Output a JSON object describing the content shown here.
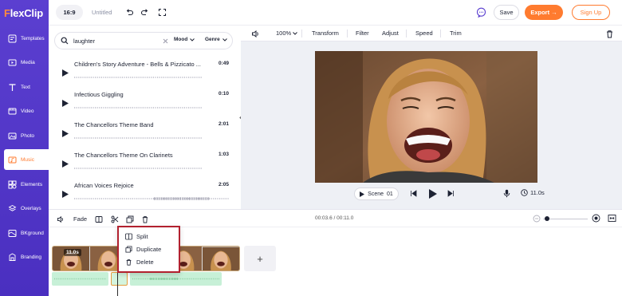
{
  "brand": {
    "logo_a": "F",
    "logo_b": "lexClip",
    "accent": "#ff7a2e",
    "sidebar_color": "#5233c8"
  },
  "sidebar": {
    "items": [
      {
        "label": "Templates",
        "icon": "templates-icon"
      },
      {
        "label": "Media",
        "icon": "media-icon"
      },
      {
        "label": "Text",
        "icon": "text-icon"
      },
      {
        "label": "Video",
        "icon": "video-icon"
      },
      {
        "label": "Photo",
        "icon": "photo-icon"
      },
      {
        "label": "Music",
        "icon": "music-icon",
        "active": true
      },
      {
        "label": "Elements",
        "icon": "elements-icon"
      },
      {
        "label": "Overlays",
        "icon": "overlays-icon"
      },
      {
        "label": "BKground",
        "icon": "background-icon"
      },
      {
        "label": "Branding",
        "icon": "branding-icon"
      }
    ]
  },
  "topbar": {
    "ratio": "16:9",
    "title": "Untitled",
    "save": "Save",
    "export": "Export →",
    "signup": "Sign Up"
  },
  "music": {
    "search_value": "laughter",
    "mood": "Mood",
    "genre": "Genre",
    "tracks": [
      {
        "name": "Children's Story Adventure - Bells & Pizzicato ...",
        "duration": "0:49"
      },
      {
        "name": "Infectious Giggling",
        "duration": "0:10"
      },
      {
        "name": "The Chancellors Theme Band",
        "duration": "2:01"
      },
      {
        "name": "The Chancellors Theme On Clarinets",
        "duration": "1:03"
      },
      {
        "name": "African Voices Rejoice",
        "duration": "2:05"
      }
    ]
  },
  "preview_toolbar": {
    "zoom": "100%",
    "transform": "Transform",
    "filter": "Filter",
    "adjust": "Adjust",
    "speed": "Speed",
    "trim": "Trim"
  },
  "player": {
    "scene": "Scene",
    "scene_no": "01",
    "duration": "11.0s"
  },
  "timeline": {
    "fade": "Fade",
    "timecode": "00:03.6 / 00:11.0",
    "clip_badge": "11.0s",
    "add": "+"
  },
  "context_menu": {
    "items": [
      "Split",
      "Duplicate",
      "Delete"
    ]
  }
}
